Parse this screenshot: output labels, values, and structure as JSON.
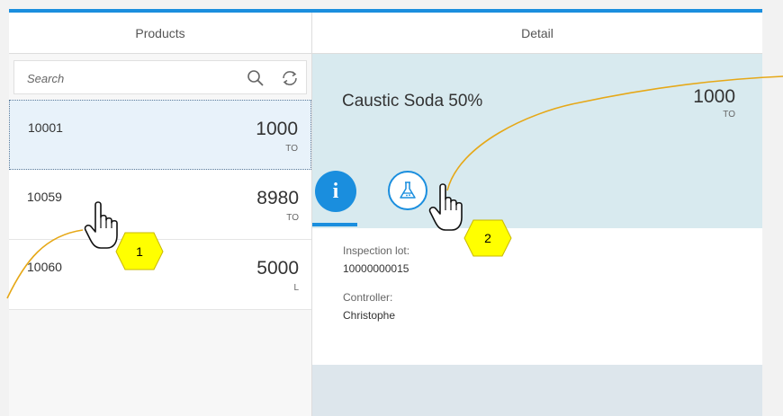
{
  "master": {
    "header": "Products",
    "search_placeholder": "Search",
    "items": [
      {
        "id": "10001",
        "number": "1000",
        "unit": "TO"
      },
      {
        "id": "10059",
        "number": "8980",
        "unit": "TO"
      },
      {
        "id": "10060",
        "number": "5000",
        "unit": "L"
      }
    ]
  },
  "detail": {
    "header": "Detail",
    "title": "Caustic Soda 50%",
    "number": "1000",
    "unit": "TO",
    "fields": [
      {
        "label": "Inspection lot:",
        "value": "10000000015"
      },
      {
        "label": "Controller:",
        "value": "Christophe"
      }
    ]
  },
  "annotations": {
    "badge_1": "1",
    "badge_2": "2"
  },
  "colors": {
    "accent": "#1a8ede",
    "header_bg": "#d8eaef",
    "selected_bg": "#e8f2fa",
    "callout_line": "#e6a817",
    "badge_fill": "#ffff00"
  },
  "icons": {
    "search": "search-icon",
    "refresh": "refresh-icon",
    "info_tab": "info-icon",
    "lab_tab": "flask-icon",
    "pointer": "hand-pointer-icon"
  }
}
